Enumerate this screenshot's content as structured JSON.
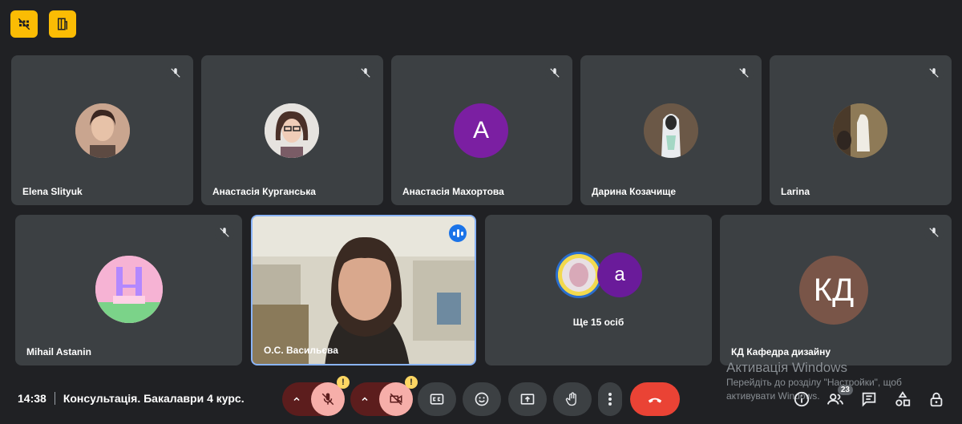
{
  "participants_row1": [
    {
      "name": "Elena Slityuk",
      "avatar": "photo"
    },
    {
      "name": "Анастасія Курганська",
      "avatar": "photo"
    },
    {
      "name": "Анастасія Махортова",
      "avatar": "letter",
      "letter": "A",
      "color": "#7b1fa2"
    },
    {
      "name": "Дарина Козачище",
      "avatar": "photo"
    },
    {
      "name": "Larina",
      "avatar": "photo"
    }
  ],
  "participants_row2": [
    {
      "name": "Mihail Astanin",
      "avatar": "photo"
    },
    {
      "name": "О.С. Васильєва",
      "avatar": "video"
    },
    {
      "name": "Ще 15 осіб",
      "avatar": "group",
      "group_letter": "a"
    },
    {
      "name": "КД Кафедра дизайну",
      "avatar": "letter",
      "letter": "КД",
      "color": "#795548"
    }
  ],
  "meeting": {
    "time": "14:38",
    "title": "Консультація. Бакалаври 4 курс."
  },
  "people_count": "23",
  "watermark": {
    "title": "Активація Windows",
    "line1": "Перейдіть до розділу \"Настройки\", щоб",
    "line2": "активувати Windows."
  },
  "colors": {
    "warning": "#fbbc04",
    "end_call": "#ea4335",
    "muted_bg": "#5c1d1d",
    "speaker_border": "#8ab4f8"
  }
}
